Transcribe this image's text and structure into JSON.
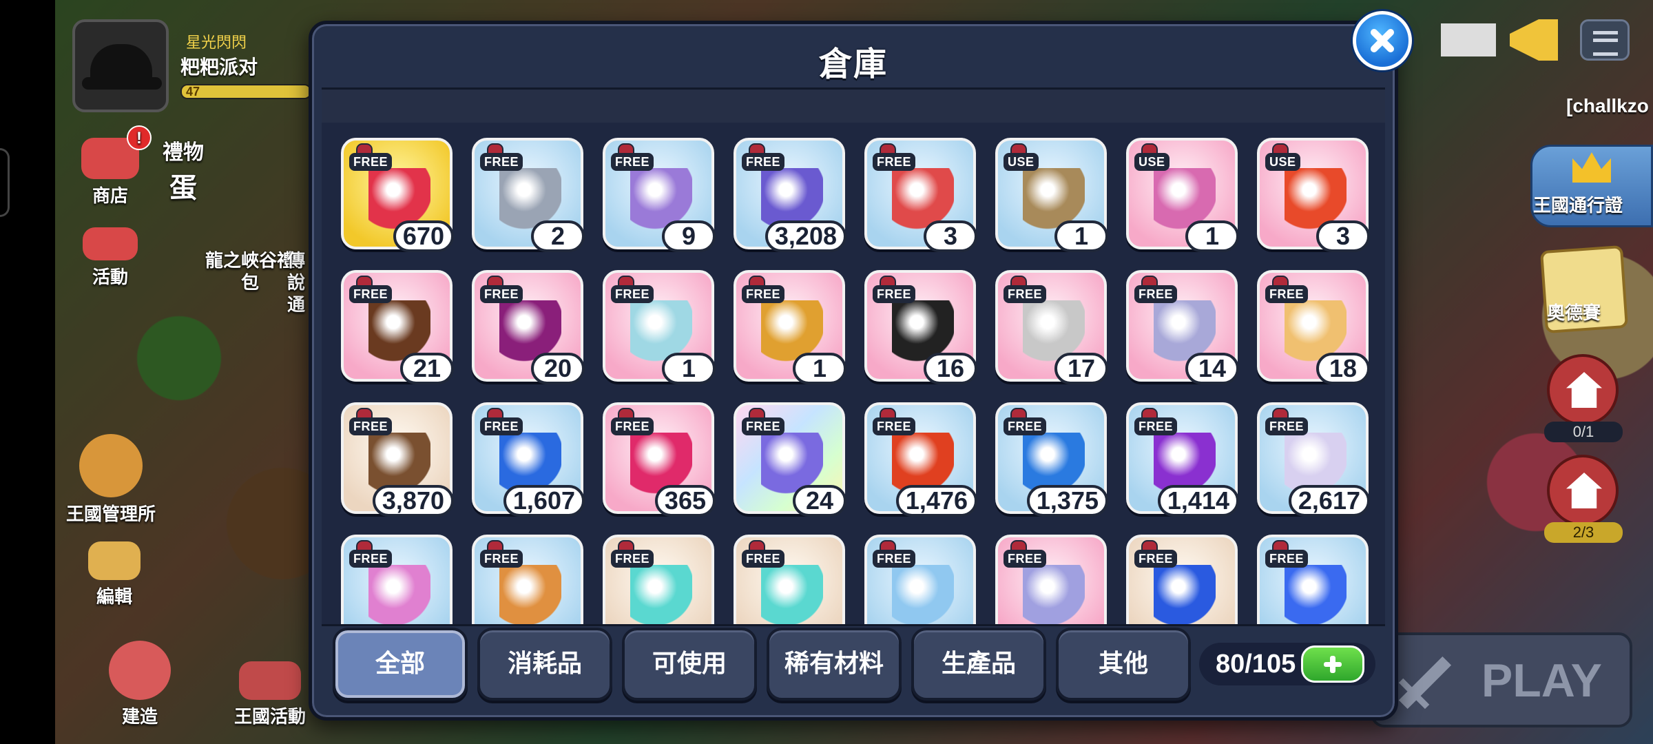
{
  "player": {
    "guild_tag": "星光閃閃",
    "name": "粑粑派对",
    "level": "47"
  },
  "left_menu": {
    "shop": "商店",
    "event": "活動",
    "gift_title": "禮物",
    "gift_sub": "蛋",
    "dragon_pack": "龍之峽谷禮包",
    "legend_partial": "傳說通",
    "kingdom_admin": "王國管理所",
    "edit": "編輯",
    "build": "建造",
    "kingdom_event": "王國活動",
    "shop_badge": "!"
  },
  "right_menu": {
    "challenger": "[challkzo",
    "kingdom_pass": "王國通行證",
    "odyssey": "奧德賽",
    "house1_count": "0/1",
    "house2_count": "2/3",
    "play": "PLAY"
  },
  "modal": {
    "title": "倉庫",
    "capacity": "80/105",
    "tabs": [
      "全部",
      "消耗品",
      "可使用",
      "稀有材料",
      "生產品",
      "其他"
    ]
  },
  "items": [
    {
      "tag": "FREE",
      "count": "670",
      "bg": "gold",
      "icon": "dragon-fruit-gem-icon",
      "color": "#e2334a"
    },
    {
      "tag": "FREE",
      "count": "2",
      "bg": "blue",
      "icon": "silver-cookie-cutter-icon",
      "color": "#9aa4b4"
    },
    {
      "tag": "FREE",
      "count": "9",
      "bg": "blue",
      "icon": "purple-cookie-cutter-icon",
      "color": "#9a7ad8"
    },
    {
      "tag": "FREE",
      "count": "3,208",
      "bg": "blue",
      "icon": "crystal-flower-icon",
      "color": "#6a5ad0"
    },
    {
      "tag": "FREE",
      "count": "3",
      "bg": "blue",
      "icon": "red-upgrade-card-icon",
      "color": "#e04a4a"
    },
    {
      "tag": "USE",
      "count": "1",
      "bg": "blue",
      "icon": "wooden-shield-token-icon",
      "color": "#a88a5a"
    },
    {
      "tag": "USE",
      "count": "1",
      "bg": "pink",
      "icon": "heart-chest-icon",
      "color": "#d86ab0"
    },
    {
      "tag": "USE",
      "count": "3",
      "bg": "pink",
      "icon": "red-spark-card-icon",
      "color": "#e84a2a"
    },
    {
      "tag": "FREE",
      "count": "21",
      "bg": "pink",
      "icon": "coffee-cup-icon",
      "color": "#6a3a20"
    },
    {
      "tag": "FREE",
      "count": "20",
      "bg": "pink",
      "icon": "purple-rose-icon",
      "color": "#8a1f7a"
    },
    {
      "tag": "FREE",
      "count": "1",
      "bg": "pink",
      "icon": "potion-jar-icon",
      "color": "#9fd8e4"
    },
    {
      "tag": "FREE",
      "count": "1",
      "bg": "pink",
      "icon": "golden-wheat-icon",
      "color": "#e0a030"
    },
    {
      "tag": "FREE",
      "count": "16",
      "bg": "pink",
      "icon": "black-gold-beetle-icon",
      "color": "#222222"
    },
    {
      "tag": "FREE",
      "count": "17",
      "bg": "pink",
      "icon": "moon-rock-icon",
      "color": "#c8c8c8"
    },
    {
      "tag": "FREE",
      "count": "14",
      "bg": "pink",
      "icon": "lavender-stone-icon",
      "color": "#a8a8d8"
    },
    {
      "tag": "FREE",
      "count": "18",
      "bg": "pink",
      "icon": "cream-puff-icon",
      "color": "#f0c070"
    },
    {
      "tag": "FREE",
      "count": "3,870",
      "bg": "beige",
      "icon": "brown-crystal-icon",
      "color": "#7a5030"
    },
    {
      "tag": "FREE",
      "count": "1,607",
      "bg": "blue",
      "icon": "blue-crystal-icon",
      "color": "#2a6ae0"
    },
    {
      "tag": "FREE",
      "count": "365",
      "bg": "pink",
      "icon": "pink-crystal-icon",
      "color": "#e02a6a"
    },
    {
      "tag": "FREE",
      "count": "24",
      "bg": "rainbow",
      "icon": "rainbow-crystal-icon",
      "color": "#7a6ae0"
    },
    {
      "tag": "FREE",
      "count": "1,476",
      "bg": "blue",
      "icon": "red-lightning-emblem-icon",
      "color": "#e04020"
    },
    {
      "tag": "FREE",
      "count": "1,375",
      "bg": "blue",
      "icon": "blue-wave-emblem-icon",
      "color": "#2a7ae0"
    },
    {
      "tag": "FREE",
      "count": "1,414",
      "bg": "blue",
      "icon": "purple-moon-emblem-icon",
      "color": "#8a30d0"
    },
    {
      "tag": "FREE",
      "count": "2,617",
      "bg": "blue",
      "icon": "white-cross-emblem-icon",
      "color": "#d8d0f0"
    },
    {
      "tag": "FREE",
      "count": "",
      "bg": "blue",
      "icon": "rainbow-star-icon",
      "color": "#e080d0"
    },
    {
      "tag": "FREE",
      "count": "",
      "bg": "blue",
      "icon": "orange-diamond-icon",
      "color": "#e09040"
    },
    {
      "tag": "FREE",
      "count": "",
      "bg": "beige",
      "icon": "teal-gem-cluster-icon",
      "color": "#5ad8d0"
    },
    {
      "tag": "FREE",
      "count": "",
      "bg": "beige",
      "icon": "teal-gem-cluster-icon",
      "color": "#5ad8d0"
    },
    {
      "tag": "FREE",
      "count": "",
      "bg": "blue",
      "icon": "rainbow-gem-bag-icon",
      "color": "#90c8f0"
    },
    {
      "tag": "FREE",
      "count": "",
      "bg": "pink",
      "icon": "candy-jar-icon",
      "color": "#a0a0e0"
    },
    {
      "tag": "FREE",
      "count": "",
      "bg": "beige",
      "icon": "blue-potion-icon",
      "color": "#2a5ae0"
    },
    {
      "tag": "FREE",
      "count": "",
      "bg": "blue",
      "icon": "blue-flame-potion-icon",
      "color": "#3a6af0"
    }
  ]
}
